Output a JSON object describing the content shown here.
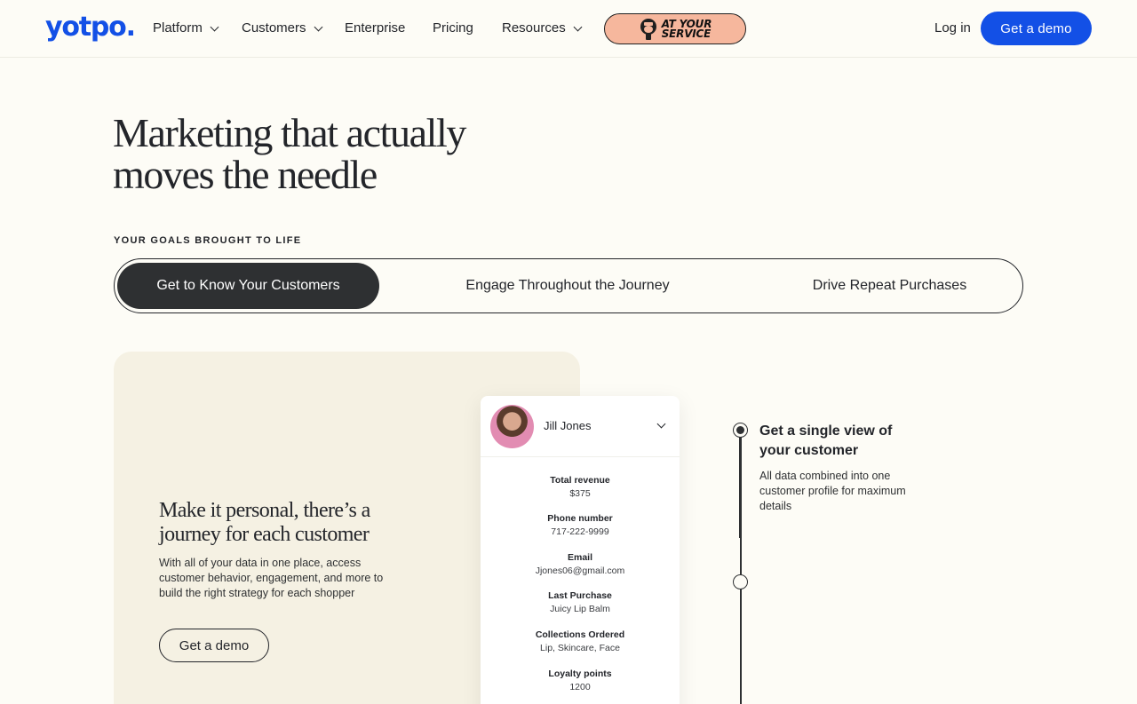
{
  "brand": {
    "logo_text": "yotpo.",
    "accent": "#1350e6"
  },
  "nav": {
    "items": [
      {
        "label": "Platform",
        "dropdown": true
      },
      {
        "label": "Customers",
        "dropdown": true
      },
      {
        "label": "Enterprise",
        "dropdown": false
      },
      {
        "label": "Pricing",
        "dropdown": false
      },
      {
        "label": "Resources",
        "dropdown": true
      }
    ],
    "promo_line1": "AT YOUR",
    "promo_line2": "SERVICE",
    "login_label": "Log in",
    "demo_label": "Get a demo"
  },
  "hero": {
    "title_line1": "Marketing that actually",
    "title_line2": "moves the needle",
    "eyebrow": "YOUR GOALS BROUGHT TO LIFE"
  },
  "tabs": [
    {
      "label": "Get to Know Your Customers",
      "active": true
    },
    {
      "label": "Engage Throughout the Journey",
      "active": false
    },
    {
      "label": "Drive Repeat Purchases",
      "active": false
    }
  ],
  "feature": {
    "title_line1": "Make it personal, there’s a",
    "title_line2": "journey for each customer",
    "description": "With all of your data in one place, access customer behavior, engagement, and more to build the right strategy for each shopper",
    "button_label": "Get a demo"
  },
  "profile": {
    "name": "Jill Jones",
    "fields": [
      {
        "label": "Total revenue",
        "value": "$375"
      },
      {
        "label": "Phone number",
        "value": "717-222-9999"
      },
      {
        "label": "Email",
        "value": "Jjones06@gmail.com"
      },
      {
        "label": "Last Purchase",
        "value": "Juicy Lip Balm"
      },
      {
        "label": "Collections Ordered",
        "value": "Lip, Skincare, Face"
      },
      {
        "label": "Loyalty points",
        "value": "1200"
      }
    ]
  },
  "timeline": {
    "step_title": "Get a single view of your customer",
    "step_description": "All data combined into one customer profile for maximum details"
  }
}
